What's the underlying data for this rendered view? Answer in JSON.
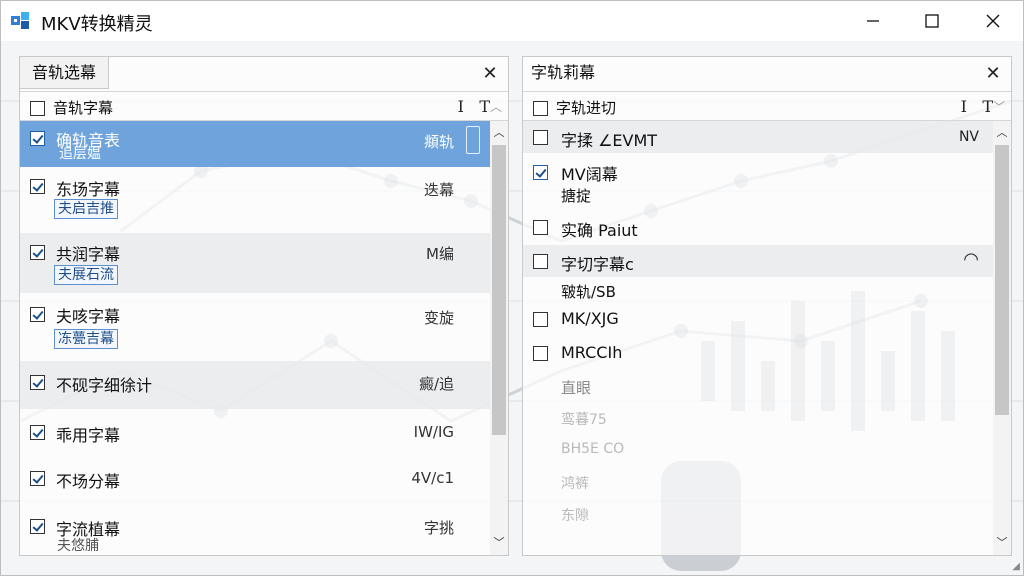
{
  "window": {
    "title": "MKV转换精灵"
  },
  "left_panel": {
    "tab_label": "音轨选幕",
    "header_label": "音轨字幕",
    "tool1": "I",
    "tool2": "T",
    "rows": [
      {
        "name": "确轨音表",
        "sub": "追层媪",
        "value": "頫轨",
        "checked": true,
        "selected": true
      },
      {
        "name": "东场字幕",
        "sub": "夫启吉推",
        "value": "迭幕",
        "checked": true
      },
      {
        "name": "共润字幕",
        "sub": "夫展石流",
        "value": "M编",
        "checked": true
      },
      {
        "name": "夫咳字幕",
        "sub": "冻甍吉幕",
        "value": "变旋",
        "checked": true
      },
      {
        "name": "不砚字细徐计",
        "sub": "",
        "value": "癜/追",
        "checked": true
      },
      {
        "name": "乖用字幕",
        "sub": "",
        "value": "IW/IG",
        "checked": true
      },
      {
        "name": "不场分幕",
        "sub": "",
        "value": "4V/c1",
        "checked": true
      },
      {
        "name": "字流植幕",
        "sub": "夫悠脯",
        "value": "字挑",
        "checked": true
      }
    ]
  },
  "right_panel": {
    "title": "字轨莉幕",
    "header_label": "字轨进切",
    "tool1": "I",
    "tool2": "T",
    "rows": [
      {
        "name": "字揉 ∠EVMT",
        "value": "NV",
        "checked": false
      },
      {
        "name": "MV阔幕",
        "sub": "搪掟",
        "value": "",
        "checked": true
      },
      {
        "name": "实确 Paiut",
        "value": "",
        "checked": false
      },
      {
        "name": "字切字幕c",
        "sub": "皲轨/SB",
        "value": "",
        "checked": false
      },
      {
        "name": "MK/XJG",
        "value": "",
        "checked": false
      },
      {
        "name": "MRCCIh",
        "value": "",
        "checked": false
      }
    ],
    "faded_items": [
      "直眼",
      "鸾暮75",
      "BH5E CO",
      "鸿裤",
      "东隙"
    ]
  },
  "colors": {
    "selection": "#6ea3dc",
    "accent": "#1f5fa6"
  }
}
